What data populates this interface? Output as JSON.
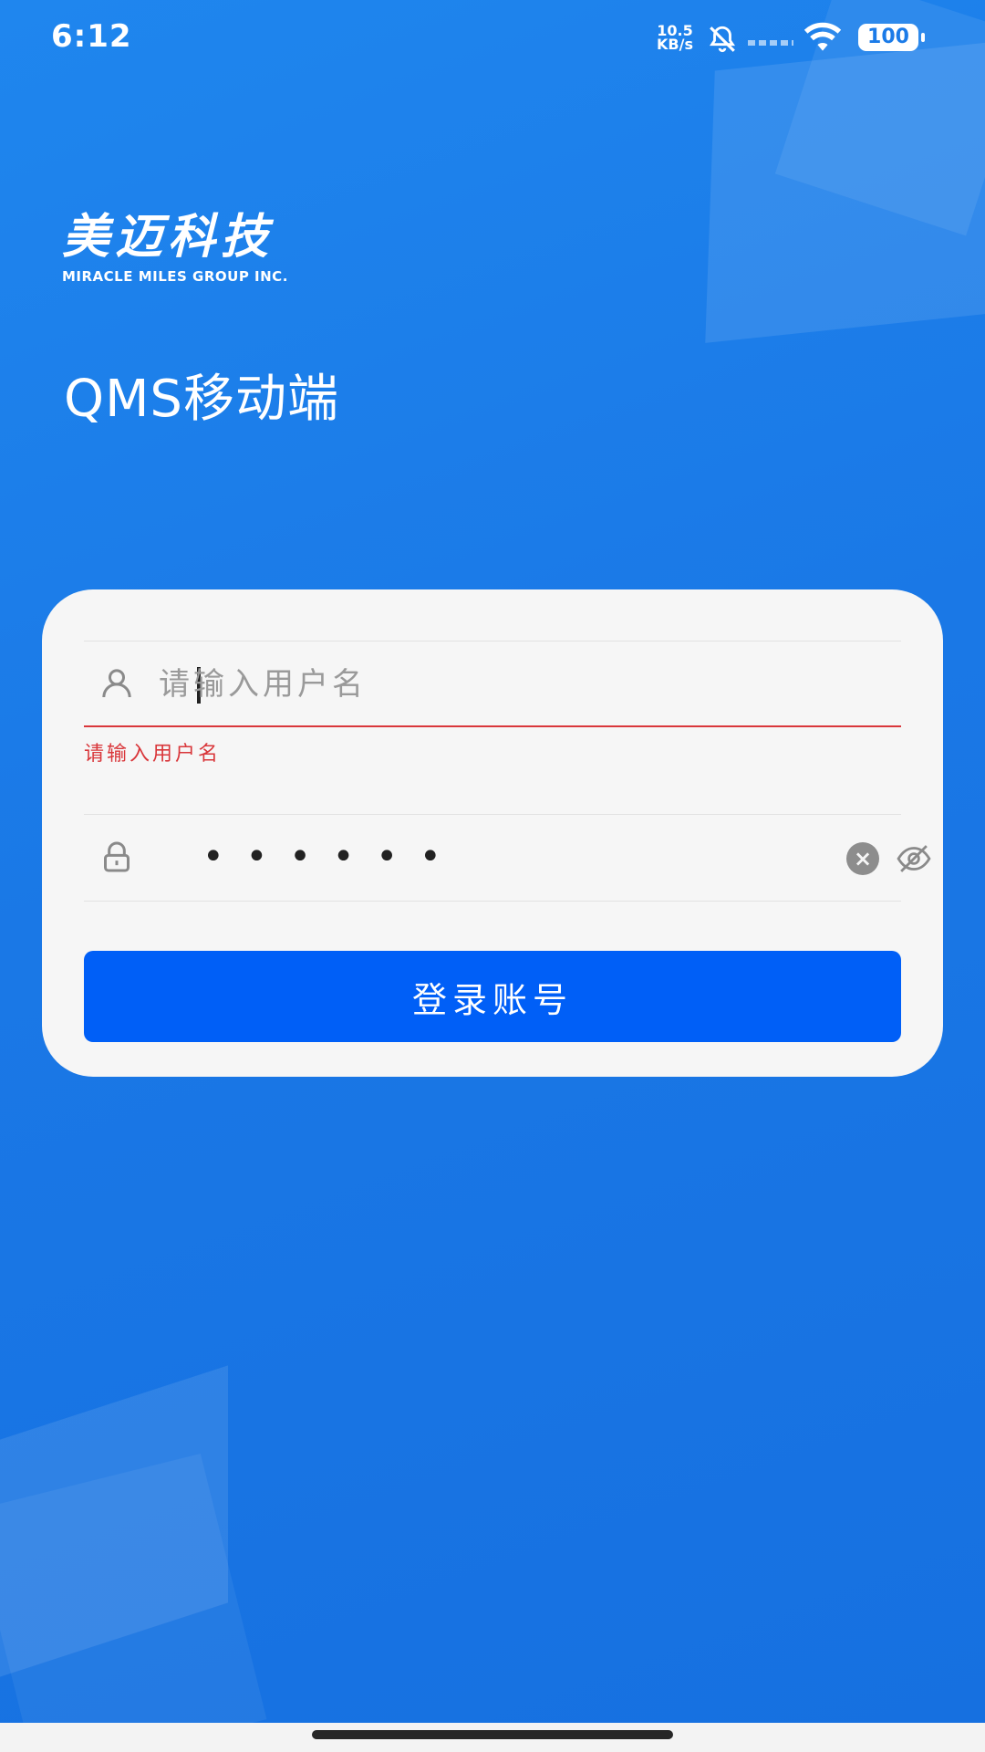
{
  "status_bar": {
    "time": "6:12",
    "net_speed_value": "10.5",
    "net_speed_unit": "KB/s",
    "battery": "100"
  },
  "logo": {
    "chinese": "美迈科技",
    "english": "MIRACLE MILES GROUP INC."
  },
  "app_title": "QMS移动端",
  "login": {
    "username_placeholder": "请输入用户名",
    "username_value": "",
    "username_error": "请输入用户名",
    "password_mask": "••••••",
    "submit_label": "登录账号"
  },
  "colors": {
    "background": "#1b7be8",
    "primary_button": "#005ff7",
    "error": "#d9373b",
    "card": "#f6f6f6"
  }
}
